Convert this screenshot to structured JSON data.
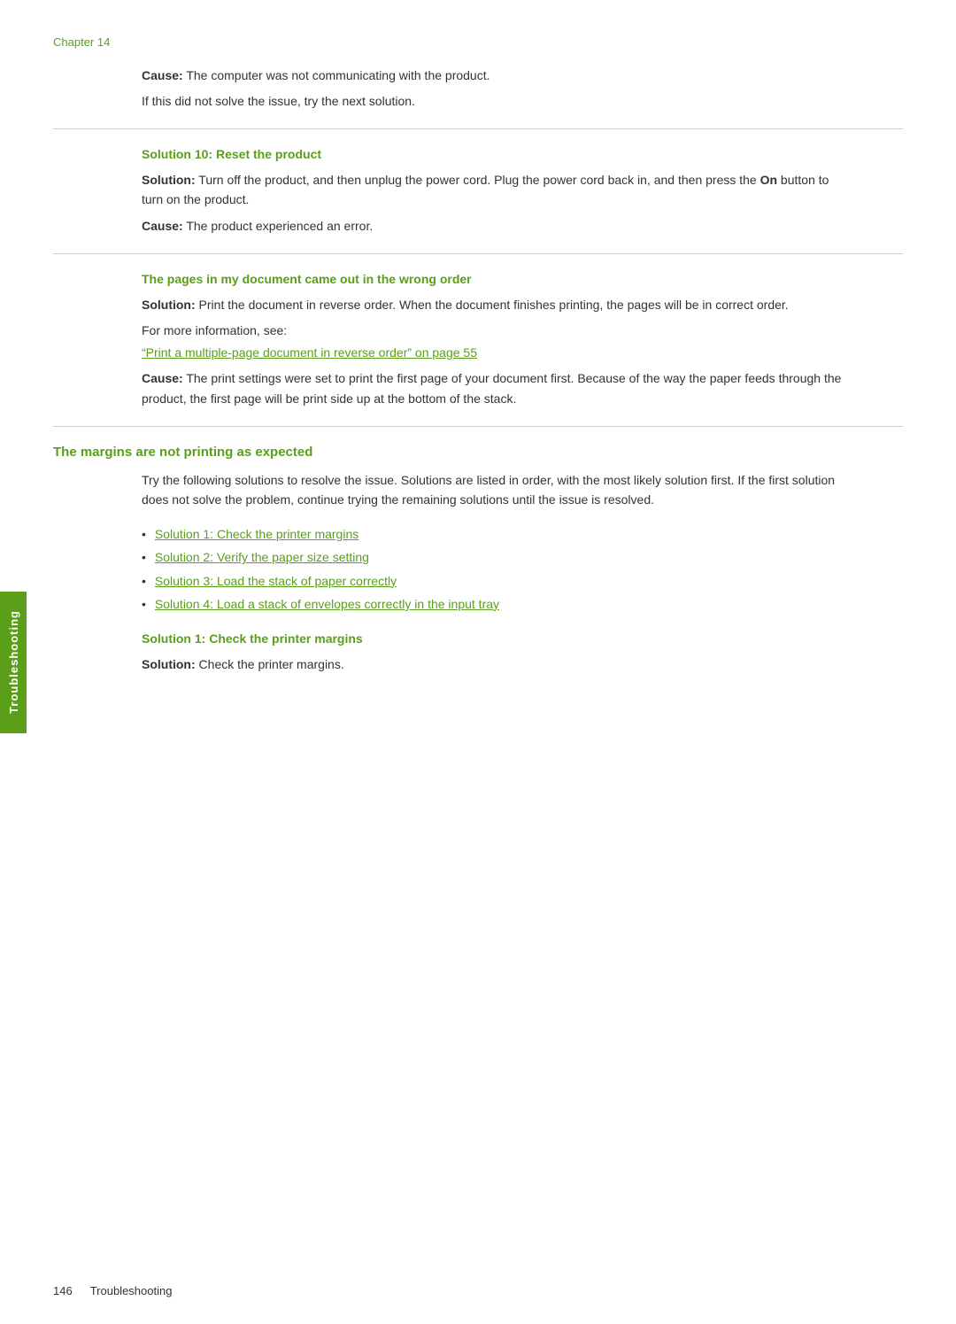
{
  "chapter": {
    "label": "Chapter 14"
  },
  "sections": [
    {
      "type": "cause_block",
      "cause": "The computer was not communicating with the product.",
      "note": "If this did not solve the issue, try the next solution."
    },
    {
      "type": "divider"
    },
    {
      "type": "subsection",
      "heading": "Solution 10: Reset the product",
      "solution": "Turn off the product, and then unplug the power cord. Plug the power cord back in, and then press the On button to turn on the product.",
      "solution_bold_word": "On",
      "cause": "The product experienced an error."
    },
    {
      "type": "divider"
    },
    {
      "type": "subsection_with_link",
      "heading": "The pages in my document came out in the wrong order",
      "solution": "Print the document in reverse order. When the document finishes printing, the pages will be in correct order.",
      "for_more_label": "For more information, see:",
      "link_text": "“Print a multiple-page document in reverse order” on page 55",
      "cause": "The print settings were set to print the first page of your document first. Because of the way the paper feeds through the product, the first page will be print side up at the bottom of the stack."
    },
    {
      "type": "divider"
    },
    {
      "type": "main_section",
      "heading": "The margins are not printing as expected",
      "intro": "Try the following solutions to resolve the issue. Solutions are listed in order, with the most likely solution first. If the first solution does not solve the problem, continue trying the remaining solutions until the issue is resolved.",
      "bullets": [
        {
          "text": "Solution 1: Check the printer margins"
        },
        {
          "text": "Solution 2: Verify the paper size setting"
        },
        {
          "text": "Solution 3: Load the stack of paper correctly"
        },
        {
          "text": "Solution 4: Load a stack of envelopes correctly in the input tray"
        }
      ],
      "subsection_heading": "Solution 1: Check the printer margins",
      "subsection_solution": "Check the printer margins."
    }
  ],
  "sidebar": {
    "label": "Troubleshooting"
  },
  "footer": {
    "page_number": "146",
    "section_label": "Troubleshooting"
  }
}
